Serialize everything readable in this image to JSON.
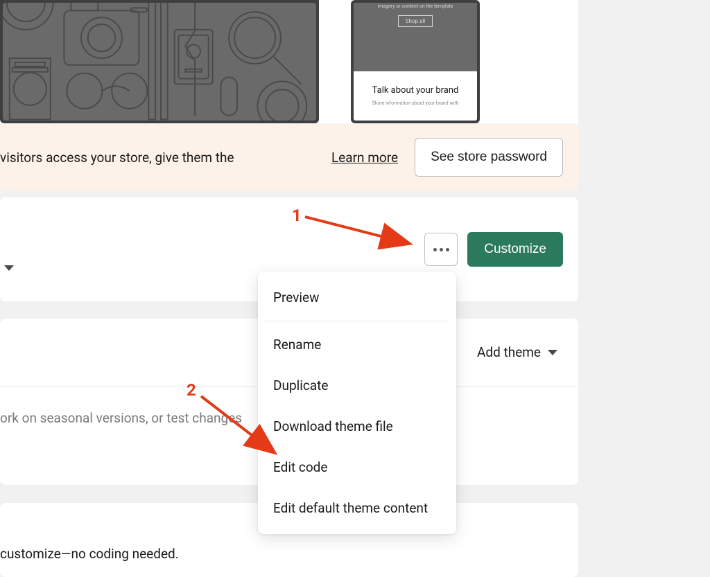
{
  "preview": {
    "mobile_top_tagline": "imagery or content on the template",
    "mobile_shop_all": "Shop all",
    "mobile_title": "Talk about your brand",
    "mobile_sub": "Share information about your brand with"
  },
  "banner": {
    "text_fragment": "visitors access your store, give them the",
    "link": "Learn more",
    "button": "See store password"
  },
  "card1": {
    "customize": "Customize"
  },
  "card2": {
    "add_theme": "Add theme",
    "body_fragment": "ork on seasonal versions, or test changes"
  },
  "card3": {
    "text_fragment": "customize—no coding needed."
  },
  "dropdown": {
    "preview": "Preview",
    "rename": "Rename",
    "duplicate": "Duplicate",
    "download": "Download theme file",
    "edit_code": "Edit code",
    "edit_default": "Edit default theme content"
  },
  "annotations": {
    "n1": "1",
    "n2": "2"
  }
}
